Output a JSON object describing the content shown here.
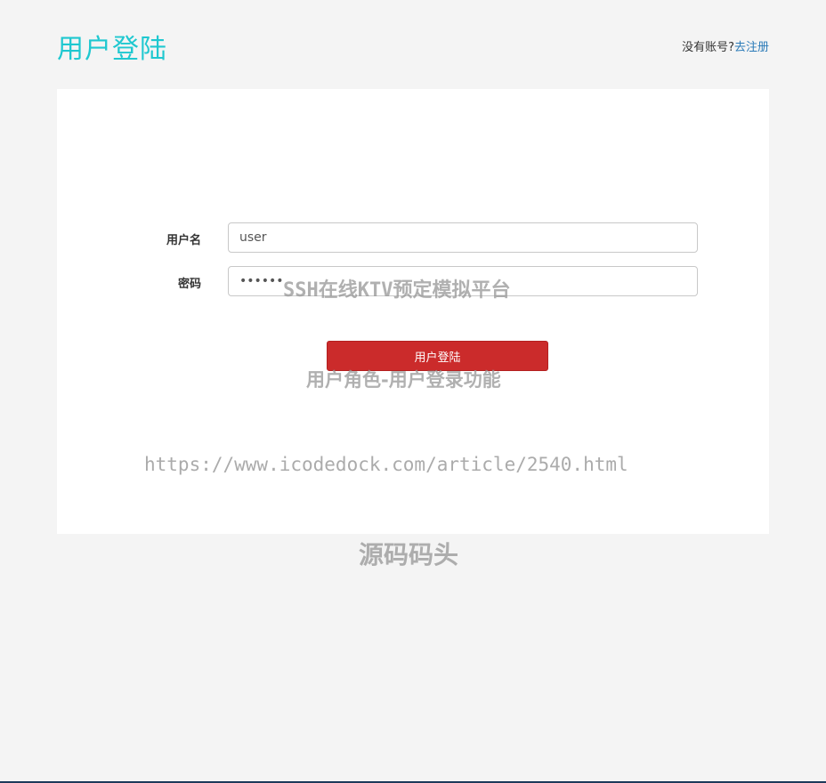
{
  "header": {
    "title": "用户登陆",
    "register_prompt": "没有账号?",
    "register_link": "去注册"
  },
  "form": {
    "username_label": "用户名",
    "username_value": "user",
    "password_label": "密码",
    "password_value": "123456",
    "submit_label": "用户登陆"
  },
  "watermarks": {
    "title": "SSH在线KTV预定模拟平台",
    "feature": "用户角色-用户登录功能",
    "url": "https://www.icodedock.com/article/2540.html",
    "brand": "源码码头"
  },
  "colors": {
    "title": "#1fc8d0",
    "link": "#2a7ab8",
    "submit": "#cb2b2b"
  }
}
